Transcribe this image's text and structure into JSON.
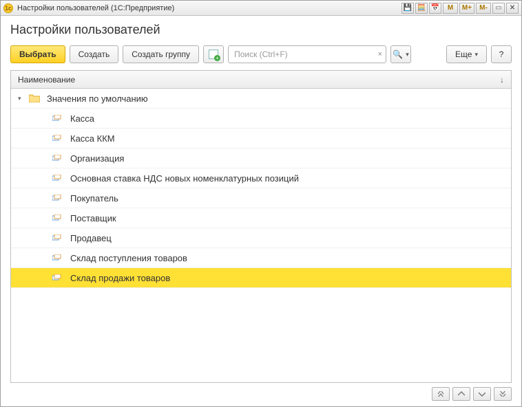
{
  "titlebar": {
    "title": "Настройки пользователей  (1С:Предприятие)",
    "m_buttons": [
      "M",
      "M+",
      "M-"
    ]
  },
  "page": {
    "title": "Настройки пользователей"
  },
  "toolbar": {
    "select": "Выбрать",
    "create": "Создать",
    "create_group": "Создать группу",
    "more": "Еще",
    "help": "?",
    "search_placeholder": "Поиск (Ctrl+F)"
  },
  "list": {
    "header": "Наименование",
    "group": "Значения по умолчанию",
    "items": [
      "Касса",
      "Касса ККМ",
      "Организация",
      "Основная ставка НДС новых номенклатурных позиций",
      "Покупатель",
      "Поставщик",
      "Продавец",
      "Склад поступления товаров",
      "Склад продажи товаров"
    ],
    "selected_index": 8
  }
}
